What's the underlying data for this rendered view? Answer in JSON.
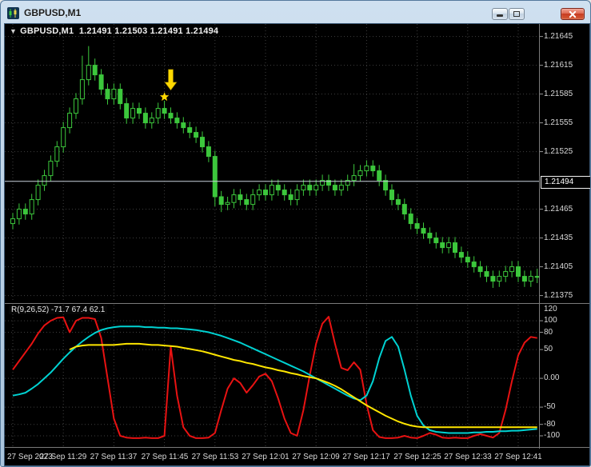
{
  "window": {
    "title": "GBPUSD,M1",
    "icon": "candlestick-chart-icon",
    "controls": [
      "minimize-icon",
      "maximize-icon",
      "close-icon"
    ]
  },
  "chart": {
    "dropdown_glyph": "▼",
    "symbol_period": "GBPUSD,M1",
    "ohlc_text": "1.21491 1.21503 1.21491 1.21494",
    "current_price_label": "1.21494",
    "indicator_label": "R(9,26,52) -71.7 67.4 62.1"
  },
  "colors": {
    "background": "#000000",
    "grid": "#3f3f3f",
    "candle": "#3cc73c",
    "current_price_line": "#c9d3dc",
    "scale_text": "#d9d9d9",
    "separator": "#7a7a7a",
    "annotation": "#ffd900",
    "osc_red": "#e81212",
    "osc_cyan": "#00d2d2",
    "osc_yellow": "#ffe600"
  },
  "chart_data": {
    "type": "candlestick",
    "symbol": "GBPUSD",
    "timeframe": "M1",
    "ylim_price": [
      1.21368,
      1.21658
    ],
    "price_ticks": [
      1.21645,
      1.21615,
      1.21585,
      1.21555,
      1.21525,
      1.21465,
      1.21435,
      1.21405,
      1.21375
    ],
    "current_price": 1.21494,
    "time_ticks": [
      {
        "i": 0,
        "label": "27 Sep 2023"
      },
      {
        "i": 8,
        "label": "27 Sep 11:29"
      },
      {
        "i": 16,
        "label": "27 Sep 11:37"
      },
      {
        "i": 24,
        "label": "27 Sep 11:45"
      },
      {
        "i": 32,
        "label": "27 Sep 11:53"
      },
      {
        "i": 40,
        "label": "27 Sep 12:01"
      },
      {
        "i": 48,
        "label": "27 Sep 12:09"
      },
      {
        "i": 56,
        "label": "27 Sep 12:17"
      },
      {
        "i": 64,
        "label": "27 Sep 12:25"
      },
      {
        "i": 72,
        "label": "27 Sep 12:33"
      },
      {
        "i": 80,
        "label": "27 Sep 12:41"
      }
    ],
    "candles_ohlc": [
      [
        1.2145,
        1.21461,
        1.21444,
        1.21455
      ],
      [
        1.21455,
        1.21471,
        1.21449,
        1.21465
      ],
      [
        1.21465,
        1.21471,
        1.21454,
        1.2146
      ],
      [
        1.2146,
        1.21481,
        1.21454,
        1.21475
      ],
      [
        1.21475,
        1.21496,
        1.21469,
        1.2149
      ],
      [
        1.2149,
        1.21506,
        1.21484,
        1.215
      ],
      [
        1.215,
        1.21521,
        1.21494,
        1.21515
      ],
      [
        1.21515,
        1.21536,
        1.21509,
        1.2153
      ],
      [
        1.2153,
        1.21556,
        1.21524,
        1.2155
      ],
      [
        1.2155,
        1.21571,
        1.21544,
        1.21565
      ],
      [
        1.21565,
        1.21586,
        1.21559,
        1.2158
      ],
      [
        1.2158,
        1.21625,
        1.21574,
        1.216
      ],
      [
        1.216,
        1.21635,
        1.21594,
        1.21615
      ],
      [
        1.21615,
        1.21622,
        1.21599,
        1.21605
      ],
      [
        1.21605,
        1.21611,
        1.21584,
        1.2159
      ],
      [
        1.2159,
        1.21596,
        1.21574,
        1.2158
      ],
      [
        1.2158,
        1.21596,
        1.21574,
        1.2159
      ],
      [
        1.2159,
        1.21596,
        1.21569,
        1.21575
      ],
      [
        1.21575,
        1.21581,
        1.21554,
        1.2156
      ],
      [
        1.2156,
        1.21576,
        1.21554,
        1.2157
      ],
      [
        1.2157,
        1.21576,
        1.21559,
        1.21565
      ],
      [
        1.21565,
        1.21571,
        1.21549,
        1.21555
      ],
      [
        1.21555,
        1.21566,
        1.21549,
        1.2156
      ],
      [
        1.2156,
        1.21576,
        1.21554,
        1.2157
      ],
      [
        1.2157,
        1.21578,
        1.21559,
        1.21565
      ],
      [
        1.21565,
        1.21571,
        1.21554,
        1.2156
      ],
      [
        1.2156,
        1.21566,
        1.21549,
        1.21555
      ],
      [
        1.21555,
        1.21561,
        1.21544,
        1.2155
      ],
      [
        1.2155,
        1.21556,
        1.21539,
        1.21545
      ],
      [
        1.21545,
        1.21551,
        1.21534,
        1.2154
      ],
      [
        1.2154,
        1.21546,
        1.21524,
        1.2153
      ],
      [
        1.2153,
        1.21536,
        1.21514,
        1.2152
      ],
      [
        1.2152,
        1.21526,
        1.21468,
        1.21478
      ],
      [
        1.21478,
        1.21484,
        1.21462,
        1.2147
      ],
      [
        1.2147,
        1.21478,
        1.21464,
        1.21472
      ],
      [
        1.21472,
        1.21486,
        1.21466,
        1.2148
      ],
      [
        1.2148,
        1.21486,
        1.21469,
        1.21475
      ],
      [
        1.21475,
        1.21481,
        1.21464,
        1.2147
      ],
      [
        1.2147,
        1.21486,
        1.21464,
        1.2148
      ],
      [
        1.2148,
        1.21491,
        1.21474,
        1.21485
      ],
      [
        1.21485,
        1.21491,
        1.21474,
        1.2148
      ],
      [
        1.2148,
        1.21496,
        1.21474,
        1.2149
      ],
      [
        1.2149,
        1.21496,
        1.21479,
        1.21485
      ],
      [
        1.21485,
        1.21491,
        1.21474,
        1.2148
      ],
      [
        1.2148,
        1.21486,
        1.21469,
        1.21475
      ],
      [
        1.21475,
        1.21491,
        1.21469,
        1.21485
      ],
      [
        1.21485,
        1.21496,
        1.21479,
        1.2149
      ],
      [
        1.2149,
        1.21496,
        1.21479,
        1.21485
      ],
      [
        1.21485,
        1.21496,
        1.21479,
        1.2149
      ],
      [
        1.2149,
        1.21501,
        1.21484,
        1.21495
      ],
      [
        1.21495,
        1.21501,
        1.21484,
        1.2149
      ],
      [
        1.2149,
        1.21496,
        1.21479,
        1.21485
      ],
      [
        1.21485,
        1.21496,
        1.21479,
        1.2149
      ],
      [
        1.2149,
        1.21501,
        1.21484,
        1.21495
      ],
      [
        1.21495,
        1.21512,
        1.21489,
        1.215
      ],
      [
        1.215,
        1.21511,
        1.21494,
        1.21505
      ],
      [
        1.21505,
        1.21516,
        1.21499,
        1.2151
      ],
      [
        1.2151,
        1.21516,
        1.21499,
        1.21505
      ],
      [
        1.21505,
        1.21511,
        1.21489,
        1.21495
      ],
      [
        1.21495,
        1.21501,
        1.21479,
        1.21485
      ],
      [
        1.21485,
        1.21491,
        1.21469,
        1.21475
      ],
      [
        1.21475,
        1.21481,
        1.21464,
        1.2147
      ],
      [
        1.2147,
        1.21476,
        1.21454,
        1.2146
      ],
      [
        1.2146,
        1.21466,
        1.21444,
        1.2145
      ],
      [
        1.2145,
        1.21456,
        1.21439,
        1.21445
      ],
      [
        1.21445,
        1.21451,
        1.21434,
        1.2144
      ],
      [
        1.2144,
        1.21446,
        1.21429,
        1.21435
      ],
      [
        1.21435,
        1.21441,
        1.21424,
        1.2143
      ],
      [
        1.2143,
        1.21436,
        1.21419,
        1.21425
      ],
      [
        1.21425,
        1.21436,
        1.21419,
        1.2143
      ],
      [
        1.2143,
        1.21436,
        1.21414,
        1.2142
      ],
      [
        1.2142,
        1.21426,
        1.21409,
        1.21415
      ],
      [
        1.21415,
        1.21421,
        1.21404,
        1.2141
      ],
      [
        1.2141,
        1.21416,
        1.21399,
        1.21405
      ],
      [
        1.21405,
        1.21411,
        1.21394,
        1.214
      ],
      [
        1.214,
        1.21406,
        1.21389,
        1.21395
      ],
      [
        1.21395,
        1.21401,
        1.21383,
        1.2139
      ],
      [
        1.2139,
        1.21401,
        1.21384,
        1.21395
      ],
      [
        1.21395,
        1.21406,
        1.21389,
        1.214
      ],
      [
        1.214,
        1.21411,
        1.21394,
        1.21405
      ],
      [
        1.21405,
        1.21411,
        1.21389,
        1.21395
      ],
      [
        1.21395,
        1.21401,
        1.21384,
        1.2139
      ],
      [
        1.2139,
        1.21401,
        1.21384,
        1.21395
      ],
      [
        1.21395,
        1.21403,
        1.21388,
        1.21394
      ]
    ],
    "annotations": {
      "arrow": {
        "index": 25,
        "price": 1.21589
      },
      "star": {
        "index": 24,
        "price": 1.21582
      }
    },
    "oscillator": {
      "label": "R(9,26,52) -71.7 67.4 62.1",
      "ylim": [
        -118,
        128
      ],
      "ticks": [
        {
          "v": 120,
          "label": "120"
        },
        {
          "v": 100,
          "label": "100"
        },
        {
          "v": 80,
          "label": "80"
        },
        {
          "v": 50,
          "label": "50"
        },
        {
          "v": 0,
          "label": "0.00"
        },
        {
          "v": -50,
          "label": "-50"
        },
        {
          "v": -80,
          "label": "-80"
        },
        {
          "v": -100,
          "label": "-100"
        }
      ],
      "grid_levels": [
        100,
        80,
        50,
        0,
        -50,
        -80,
        -100
      ],
      "series": [
        {
          "name": "red",
          "color_key": "osc_red",
          "values": [
            15,
            30,
            45,
            60,
            78,
            92,
            100,
            105,
            106,
            80,
            100,
            105,
            105,
            103,
            70,
            0,
            -70,
            -100,
            -103,
            -104,
            -104,
            -103,
            -104,
            -104,
            -100,
            55,
            -30,
            -85,
            -100,
            -104,
            -104,
            -103,
            -95,
            -55,
            -18,
            0,
            -8,
            -25,
            -12,
            3,
            8,
            -5,
            -35,
            -70,
            -95,
            -100,
            -55,
            5,
            60,
            95,
            107,
            60,
            18,
            14,
            28,
            15,
            -45,
            -90,
            -102,
            -104,
            -104,
            -103,
            -100,
            -103,
            -104,
            -100,
            -95,
            -98,
            -103,
            -104,
            -103,
            -104,
            -104,
            -100,
            -97,
            -100,
            -103,
            -95,
            -55,
            -5,
            40,
            62,
            72,
            70
          ]
        },
        {
          "name": "cyan",
          "color_key": "osc_cyan",
          "values": [
            -30,
            -28,
            -25,
            -18,
            -10,
            0,
            10,
            22,
            34,
            45,
            55,
            64,
            72,
            79,
            84,
            87,
            89,
            90,
            90,
            90,
            90,
            89,
            89,
            88,
            88,
            87,
            87,
            86,
            85,
            84,
            82,
            80,
            77,
            74,
            70,
            66,
            62,
            57,
            52,
            47,
            42,
            37,
            32,
            27,
            22,
            17,
            12,
            6,
            0,
            -6,
            -12,
            -18,
            -24,
            -30,
            -35,
            -38,
            -30,
            -5,
            35,
            65,
            72,
            55,
            15,
            -30,
            -65,
            -82,
            -90,
            -93,
            -94,
            -95,
            -95,
            -95,
            -95,
            -94,
            -94,
            -93,
            -93,
            -92,
            -92,
            -91,
            -91,
            -90,
            -89,
            -88
          ]
        },
        {
          "name": "yellow",
          "color_key": "osc_yellow",
          "values": [
            null,
            null,
            null,
            null,
            null,
            null,
            null,
            null,
            null,
            50,
            55,
            57,
            58,
            58,
            58,
            58,
            58,
            59,
            60,
            60,
            60,
            59,
            58,
            58,
            57,
            56,
            55,
            53,
            51,
            49,
            47,
            44,
            41,
            38,
            35,
            32,
            30,
            27,
            25,
            22,
            19,
            17,
            14,
            12,
            9,
            7,
            4,
            2,
            0,
            -4,
            -8,
            -13,
            -19,
            -26,
            -33,
            -40,
            -47,
            -53,
            -59,
            -65,
            -70,
            -75,
            -79,
            -82,
            -84,
            -85,
            -85,
            -85,
            -85,
            -85,
            -85,
            -85,
            -85,
            -85,
            -85,
            -85,
            -85,
            -85,
            -85,
            -85,
            -85,
            -85,
            -85,
            -85
          ]
        }
      ]
    }
  }
}
